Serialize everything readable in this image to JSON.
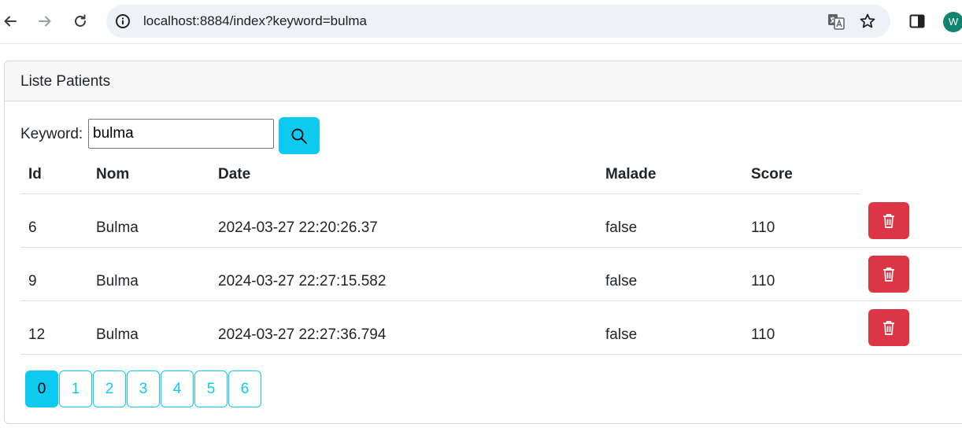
{
  "browser": {
    "url": "localhost:8884/index?keyword=bulma",
    "profile_initial": "W"
  },
  "card": {
    "title": "Liste Patients"
  },
  "search": {
    "label": "Keyword:",
    "value": "bulma"
  },
  "table": {
    "headers": [
      "Id",
      "Nom",
      "Date",
      "Malade",
      "Score"
    ],
    "rows": [
      {
        "id": "6",
        "nom": "Bulma",
        "date": "2024-03-27 22:20:26.37",
        "malade": "false",
        "score": "110"
      },
      {
        "id": "9",
        "nom": "Bulma",
        "date": "2024-03-27 22:27:15.582",
        "malade": "false",
        "score": "110"
      },
      {
        "id": "12",
        "nom": "Bulma",
        "date": "2024-03-27 22:27:36.794",
        "malade": "false",
        "score": "110"
      }
    ]
  },
  "pagination": {
    "pages": [
      "0",
      "1",
      "2",
      "3",
      "4",
      "5",
      "6"
    ],
    "current": "0"
  },
  "colors": {
    "info": "#0dcaf0",
    "danger": "#dc3545"
  }
}
